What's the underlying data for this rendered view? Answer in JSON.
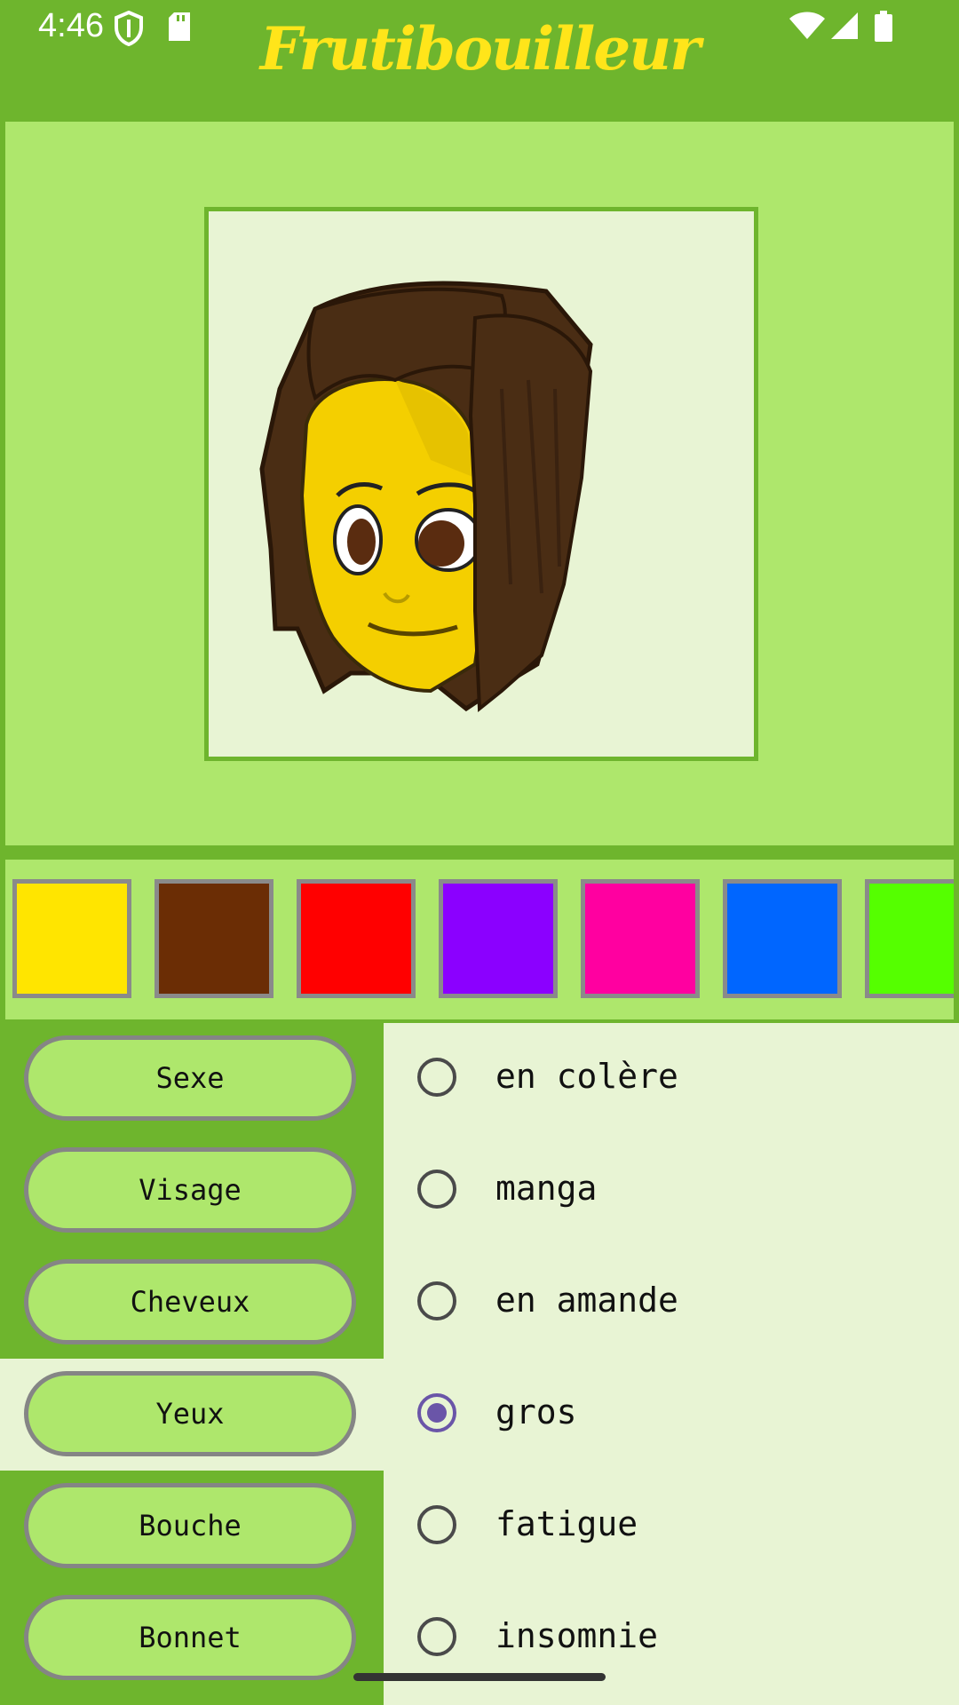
{
  "status_bar": {
    "time": "4:46",
    "icons": [
      "shield-icon",
      "sd-card-icon",
      "wifi-icon",
      "signal-icon",
      "battery-icon"
    ]
  },
  "app": {
    "title": "Frutibouilleur"
  },
  "palette": {
    "colors": [
      "#ffe500",
      "#6b2d05",
      "#ff0000",
      "#8b00ff",
      "#ff00a0",
      "#0066ff",
      "#55ff00"
    ]
  },
  "menu": {
    "items": [
      {
        "label": "Sexe"
      },
      {
        "label": "Visage"
      },
      {
        "label": "Cheveux"
      },
      {
        "label": "Yeux"
      },
      {
        "label": "Bouche"
      },
      {
        "label": "Bonnet"
      }
    ],
    "active": "Yeux"
  },
  "options": {
    "items": [
      {
        "label": "en colère",
        "checked": false
      },
      {
        "label": "manga",
        "checked": false
      },
      {
        "label": "en amande",
        "checked": false
      },
      {
        "label": "gros",
        "checked": true
      },
      {
        "label": "fatigue",
        "checked": false
      },
      {
        "label": "insomnie",
        "checked": false
      }
    ]
  },
  "colors": {
    "app_bar": "#6eb52d",
    "panel": "#aee76c",
    "frame_bg": "#e8f4d4",
    "title": "#ffe51a",
    "radio_checked": "#6a55a8"
  }
}
